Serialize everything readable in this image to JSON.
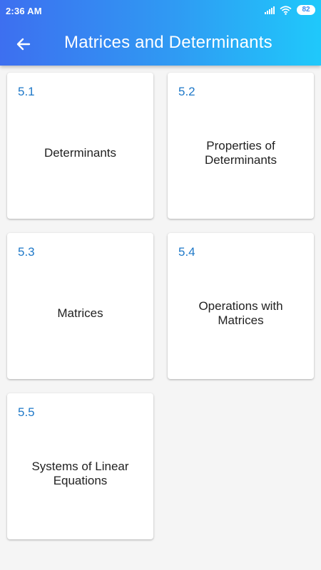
{
  "status_bar": {
    "time": "2:36 AM",
    "battery": "82",
    "icons": [
      "signal-icon",
      "wifi-icon",
      "battery-icon"
    ]
  },
  "app_bar": {
    "title": "Matrices and Determinants",
    "back_icon": "arrow-back-icon"
  },
  "colors": {
    "gradient_start": "#3d6ff0",
    "gradient_end": "#1fc9fb",
    "card_number": "#1e78c8",
    "background": "#f5f5f5"
  },
  "cards": [
    {
      "number": "5.1",
      "title": "Determinants"
    },
    {
      "number": "5.2",
      "title": "Properties of Determinants"
    },
    {
      "number": "5.3",
      "title": "Matrices"
    },
    {
      "number": "5.4",
      "title": "Operations with Matrices"
    },
    {
      "number": "5.5",
      "title": "Systems of Linear Equations"
    }
  ]
}
